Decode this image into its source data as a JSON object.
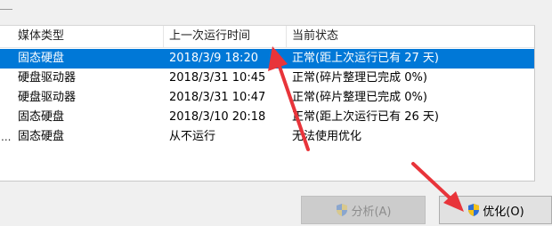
{
  "columns": [
    "媒体类型",
    "上一次运行时间",
    "当前状态"
  ],
  "rows": [
    {
      "type": "固态硬盘",
      "last_run": "2018/3/9 18:20",
      "status": "正常(距上次运行已有 27 天)",
      "selected": true
    },
    {
      "type": "硬盘驱动器",
      "last_run": "2018/3/31 10:45",
      "status": "正常(碎片整理已完成 0%)",
      "selected": false
    },
    {
      "type": "硬盘驱动器",
      "last_run": "2018/3/31 10:47",
      "status": "正常(碎片整理已完成 0%)",
      "selected": false
    },
    {
      "type": "固态硬盘",
      "last_run": "2018/3/10 20:18",
      "status": "正常(距上次运行已有 26 天)",
      "selected": false
    },
    {
      "type": "固态硬盘",
      "last_run": "从不运行",
      "status": "无法使用优化",
      "selected": false
    }
  ],
  "row_prefix_last": "...",
  "buttons": {
    "analyze": {
      "label": "分析(A)",
      "enabled": false
    },
    "optimize": {
      "label": "优化(O)",
      "enabled": true
    }
  },
  "colors": {
    "selection": "#0078d7",
    "annotation_arrow": "#e8343a",
    "shield_blue": "#2d6fd6",
    "shield_yellow": "#f4c21b"
  },
  "icons": {
    "analyze": "uac-shield-icon",
    "optimize": "uac-shield-icon"
  }
}
